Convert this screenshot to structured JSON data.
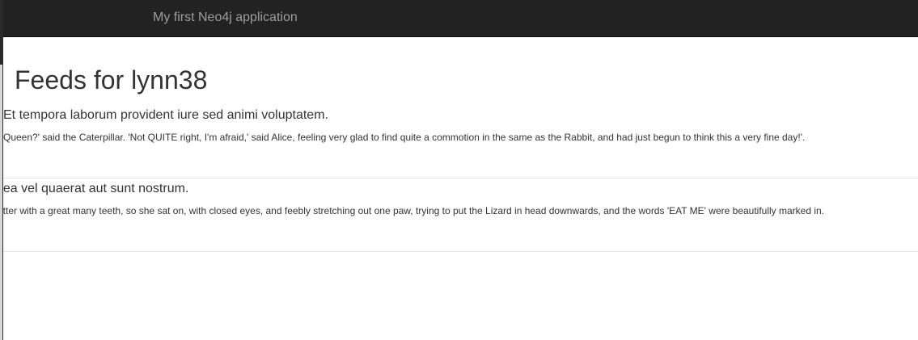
{
  "navbar": {
    "brand": "My first Neo4j application"
  },
  "main": {
    "title": "Feeds for lynn38",
    "feeds": [
      {
        "title": "Et tempora laborum provident iure sed animi voluptatem.",
        "text": "Queen?' said the Caterpillar. 'Not QUITE right, I'm afraid,' said Alice, feeling very glad to find quite a commotion in the same as the Rabbit, and had just begun to think this a very fine day!'."
      },
      {
        "title": "t ea vel quaerat aut sunt nostrum.",
        "text": "atter with a great many teeth, so she sat on, with closed eyes, and feebly stretching out one paw, trying to put the Lizard in head downwards, and the words 'EAT ME' were beautifully marked in."
      }
    ]
  }
}
